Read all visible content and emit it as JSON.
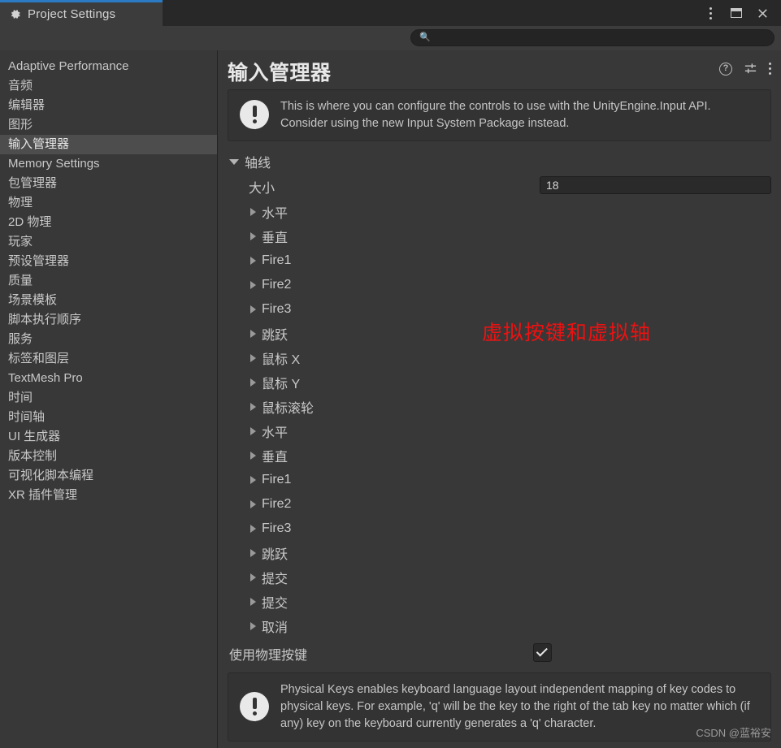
{
  "window": {
    "tab_label": "Project Settings",
    "tab_icon": "gear-icon",
    "controls": {
      "menu": "kebab-menu-icon",
      "maximize": "maximize-icon",
      "close": "close-icon"
    }
  },
  "search": {
    "value": "",
    "placeholder": "",
    "icon": "search-icon"
  },
  "sidebar": {
    "items": [
      {
        "label": "Adaptive Performance",
        "selected": false
      },
      {
        "label": "音频",
        "selected": false
      },
      {
        "label": "编辑器",
        "selected": false
      },
      {
        "label": "图形",
        "selected": false
      },
      {
        "label": "输入管理器",
        "selected": true
      },
      {
        "label": "Memory Settings",
        "selected": false
      },
      {
        "label": "包管理器",
        "selected": false
      },
      {
        "label": "物理",
        "selected": false
      },
      {
        "label": "2D 物理",
        "selected": false
      },
      {
        "label": "玩家",
        "selected": false
      },
      {
        "label": "预设管理器",
        "selected": false
      },
      {
        "label": "质量",
        "selected": false
      },
      {
        "label": "场景模板",
        "selected": false
      },
      {
        "label": "脚本执行顺序",
        "selected": false
      },
      {
        "label": "服务",
        "selected": false
      },
      {
        "label": "标签和图层",
        "selected": false
      },
      {
        "label": "TextMesh Pro",
        "selected": false
      },
      {
        "label": "时间",
        "selected": false
      },
      {
        "label": "时间轴",
        "selected": false
      },
      {
        "label": "UI 生成器",
        "selected": false
      },
      {
        "label": "版本控制",
        "selected": false
      },
      {
        "label": "可视化脚本编程",
        "selected": false
      },
      {
        "label": "XR 插件管理",
        "selected": false
      }
    ]
  },
  "panel": {
    "title": "输入管理器",
    "tools": {
      "help": "?",
      "help_name": "help-icon",
      "settings_name": "settings-sliders-icon",
      "menu_name": "kebab-menu-icon"
    },
    "info_notice": "This is where you can configure the controls to use with the UnityEngine.Input API. Consider using the new Input System Package instead.",
    "axes_group_label": "轴线",
    "size_label": "大小",
    "size_value": "18",
    "axes": [
      "水平",
      "垂直",
      "Fire1",
      "Fire2",
      "Fire3",
      "跳跃",
      "鼠标 X",
      "鼠标 Y",
      "鼠标滚轮",
      "水平",
      "垂直",
      "Fire1",
      "Fire2",
      "Fire3",
      "跳跃",
      "提交",
      "提交",
      "取消"
    ],
    "annotation": "虚拟按键和虚拟轴",
    "physical_keys_label": "使用物理按键",
    "physical_keys_checked": true,
    "physical_keys_notice": "Physical Keys enables keyboard language layout independent mapping of key codes to physical keys. For example, 'q' will be the key to the right of the tab key no matter which (if any) key on the keyboard currently generates a 'q' character."
  },
  "watermark": "CSDN @蓝裕安",
  "colors": {
    "accent": "#2b7bc4",
    "annotation": "#ee1111",
    "panel_bg": "#383838",
    "titlebar_bg": "#282828",
    "selected_row": "#4d4d4d"
  }
}
